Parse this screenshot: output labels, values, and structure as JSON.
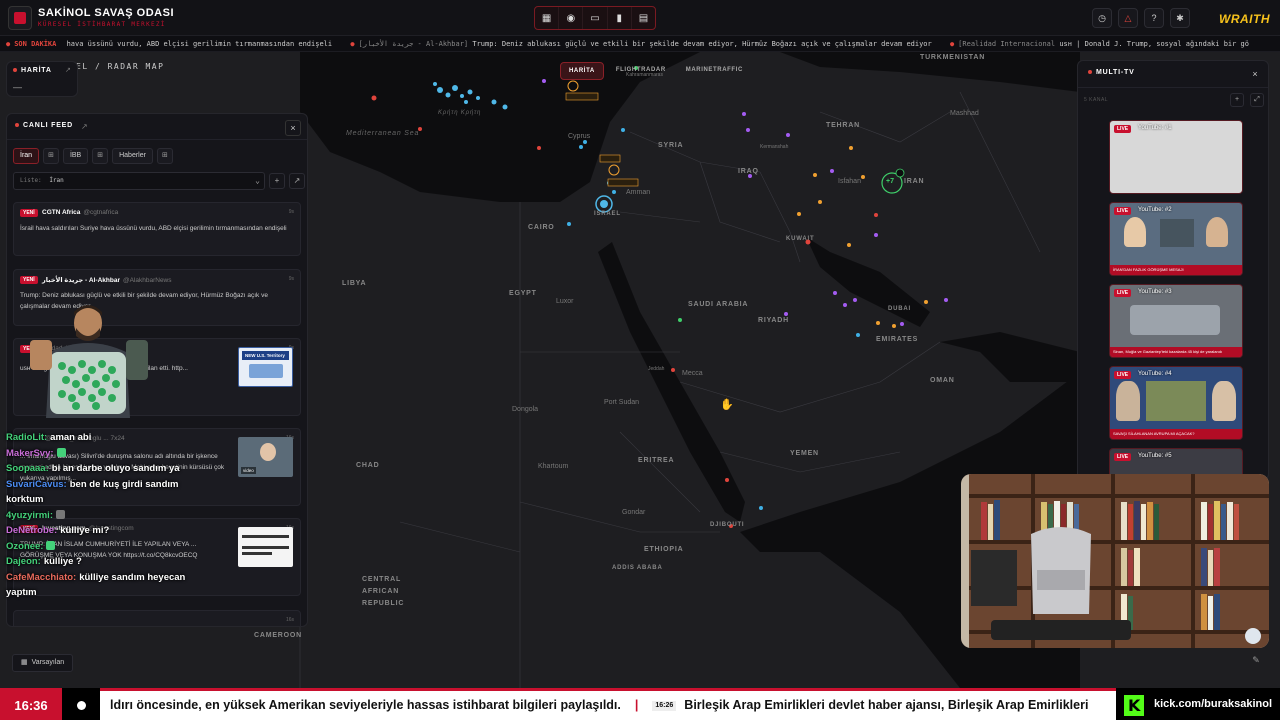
{
  "header": {
    "title": "SAKİNOL SAVAŞ ODASI",
    "subtitle": "KÜRESEL İSTİHBARAT MERKEZİ",
    "brand": "WRAITH"
  },
  "ticker": {
    "tag": "SON DAKİKA",
    "items": [
      {
        "source": "",
        "text": "hava üssünü vurdu, ABD elçisi gerilimin tırmanmasından endişeli"
      },
      {
        "source": "[جريدة الأخبار - Al-Akhbar]",
        "text": "Trump: Deniz ablukası güçlü ve etkili bir şekilde devam ediyor, Hürmüz Boğazı açık ve çalışmalar devam ediyor"
      },
      {
        "source": "[Realidad Internacional",
        "text": "usн | Donald J. Trump, sosyal ağındaki bir gö"
      }
    ]
  },
  "map": {
    "title": "EL / RADAR MAP",
    "modes": [
      "HARİTA",
      "FLIGHTRADAR",
      "MARINETRAFFIC"
    ],
    "cluster_label": "+7",
    "labels": [
      {
        "text": "TURKMENISTAN",
        "kind": "country"
      },
      {
        "text": "Mediterranean Sea",
        "kind": "sea"
      },
      {
        "text": "Κρήτη Κρήτη",
        "kind": "sea"
      },
      {
        "text": "SYRIA",
        "kind": "country"
      },
      {
        "text": "IRAQ",
        "kind": "country"
      },
      {
        "text": "IRAN",
        "kind": "country"
      },
      {
        "text": "TEHRAN",
        "kind": "city"
      },
      {
        "text": "Mashhad",
        "kind": "city"
      },
      {
        "text": "Isfahan",
        "kind": "city"
      },
      {
        "text": "KUWAIT",
        "kind": "country"
      },
      {
        "text": "CAIRO",
        "kind": "city"
      },
      {
        "text": "EGYPT",
        "kind": "country"
      },
      {
        "text": "LIBYA",
        "kind": "country"
      },
      {
        "text": "SAUDI ARABIA",
        "kind": "country"
      },
      {
        "text": "RIYADH",
        "kind": "city"
      },
      {
        "text": "DUBAI",
        "kind": "city"
      },
      {
        "text": "EMIRATES",
        "kind": "country"
      },
      {
        "text": "OMAN",
        "kind": "country"
      },
      {
        "text": "Luxor",
        "kind": "city"
      },
      {
        "text": "Mecca",
        "kind": "city"
      },
      {
        "text": "Port Sudan",
        "kind": "city"
      },
      {
        "text": "Dongola",
        "kind": "city"
      },
      {
        "text": "Khartoum",
        "kind": "city"
      },
      {
        "text": "ERITREA",
        "kind": "country"
      },
      {
        "text": "YEMEN",
        "kind": "country"
      },
      {
        "text": "CHAD",
        "kind": "country"
      },
      {
        "text": "ETHIOPIA",
        "kind": "country"
      },
      {
        "text": "ADDIS ABABA",
        "kind": "city"
      },
      {
        "text": "CENTRAL AFRICAN REPUBLIC",
        "kind": "country"
      },
      {
        "text": "CAMEROON",
        "kind": "country"
      },
      {
        "text": "DJIBOUTI",
        "kind": "country"
      },
      {
        "text": "Gondar",
        "kind": "city"
      },
      {
        "text": "Jeddah",
        "kind": "city"
      },
      {
        "text": "Amman",
        "kind": "city"
      },
      {
        "text": "ISRAEL",
        "kind": "country"
      },
      {
        "text": "Kermanshah",
        "kind": "city"
      },
      {
        "text": "Cyprus",
        "kind": "city"
      },
      {
        "text": "Kahramanmaras",
        "kind": "city"
      }
    ]
  },
  "harita_panel": {
    "title": "HARİTA"
  },
  "feed": {
    "title": "CANLI FEED",
    "tabs": [
      "İran",
      "İBB",
      "Haberler"
    ],
    "list_label": "Liste:",
    "list_value": "İran",
    "badge": "YENİ",
    "cards": [
      {
        "author": "CGTN Africa",
        "handle": "@cgtnafrica",
        "age": "9s",
        "text": "İsrail hava saldırıları Suriye hava üssünü vurdu, ABD elçisi gerilimin tırmanmasından endişeli"
      },
      {
        "author": "جريدة الأخبار - Al-Akhbar",
        "handle": "@AlakhbarNews",
        "age": "9s",
        "text": "Trump: Deniz ablukası güçlü ve etkili bir şekilde devam ediyor, Hürmüz Boğazı açık ve çalışmalar devam ediyor"
      },
      {
        "author": "",
        "handle": "@dad_int",
        "age": "9s",
        "text": "usн ... r gönderide Hürmüz Boğazı ... olarak ilan etti. http...",
        "thumb_caption": "NEW U.S. Territory"
      },
      {
        "author": "",
        "handle": "@ekrem_imamoglu ... 7x24",
        "age": "16s",
        "text": "... İmamoğlu davası) Silivri'de duruşma salonu adı altında bir işkence merkezi adeta bir esir kampı yapılmış. Mahkeme heyetinin kürsüsü çok yukarıya yapılmış...",
        "thumb_caption": "video"
      },
      {
        "author": "Investing.com",
        "handle": "@Investingcom",
        "age": "16s",
        "text": "TRUMP: İRAN İSLAM CUMHURİYETİ İLE YAPILAN VEYA ... GÖRÜŞME VEYA KONUŞMA YOK https://t.co/CQ8kcvOECQ"
      },
      {
        "author": "",
        "handle": "",
        "age": "16s",
        "text": ""
      }
    ],
    "default_button": "Varsayılan"
  },
  "chat": [
    {
      "name": "RadioLit:",
      "color": "#44d17a",
      "msg": "aman abi"
    },
    {
      "name": "MakerSvy:",
      "color": "#c86dd7",
      "msg": ""
    },
    {
      "name": "Soopaaa:",
      "color": "#44d17a",
      "msg": "bi an darbe oluyo sandım ya"
    },
    {
      "name": "SuvariCavus:",
      "color": "#4c8df5",
      "msg": "ben de kuş girdi sandım korktum"
    },
    {
      "name": "4yuzyirmi:",
      "color": "#44d17a",
      "msg": ""
    },
    {
      "name": "DeNetrobe:",
      "color": "#c86dd7",
      "msg": "külliye mi?"
    },
    {
      "name": "Ozonee:",
      "color": "#44d17a",
      "msg": ""
    },
    {
      "name": "Dajeon:",
      "color": "#44d17a",
      "msg": "külliye ?"
    },
    {
      "name": "CafeMacchiato:",
      "color": "#e86a5c",
      "msg": "külliye sandım heyecan yaptım"
    }
  ],
  "multitv": {
    "title": "MULTI-TV",
    "sub": "5 KANAL",
    "live_label": "LIVE",
    "streams": [
      {
        "name": "YouTube: #1",
        "caption": ""
      },
      {
        "name": "YouTube: #2",
        "caption": "İRAN'DAN FAZLIK GÖRÜŞME MESAJI"
      },
      {
        "name": "YouTube: #3",
        "caption": "Sinan, Muğla ve Gaziantep'teki kazalarda 45 kişi de yaralandı"
      },
      {
        "name": "YouTube: #4",
        "caption": "SAVAŞI SİLAHLANAN AVRUPA MI AÇACAK?"
      },
      {
        "name": "YouTube: #5",
        "caption": ""
      }
    ]
  },
  "bottom": {
    "time": "16:36",
    "text_1": "ldırı öncesinde, en yüksek Amerikan seviyeleriyle hassas istihbarat bilgileri paylaşıldı.",
    "time_2": "16:26",
    "text_2": "Birleşik Arap Emirlikleri devlet haber ajansı, Birleşik Arap Emirlikleri",
    "kick_url": "kick.com/buraksakinol"
  }
}
